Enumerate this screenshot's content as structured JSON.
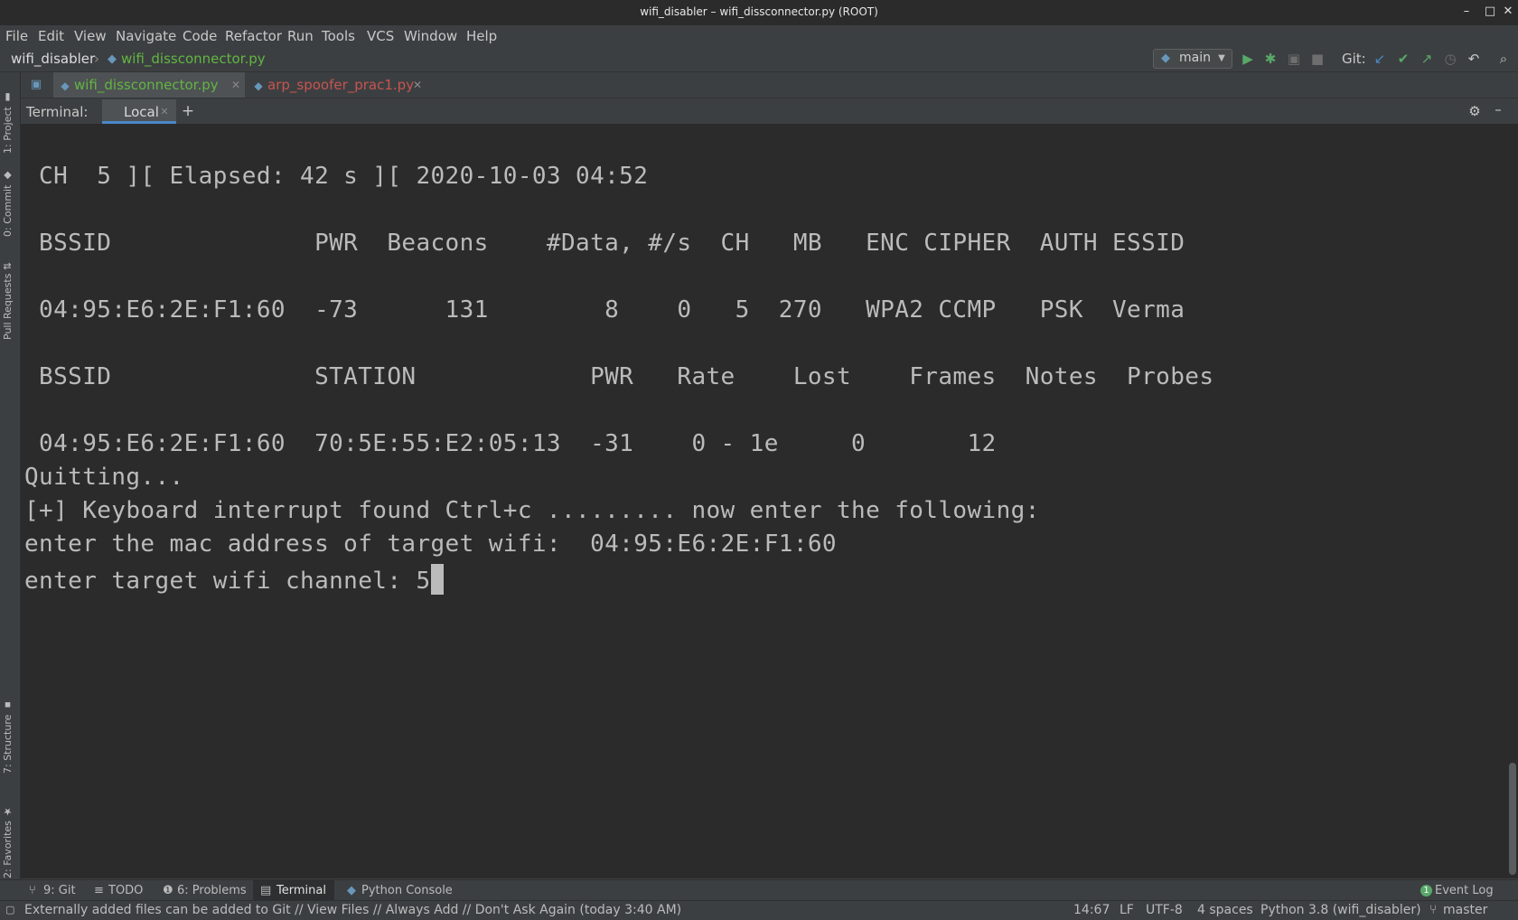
{
  "window": {
    "title": "wifi_disabler – wifi_dissconnector.py (ROOT)",
    "controls": [
      "–",
      "□",
      "✕"
    ]
  },
  "menu": [
    "File",
    "Edit",
    "View",
    "Navigate",
    "Code",
    "Refactor",
    "Run",
    "Tools",
    "VCS",
    "Window",
    "Help"
  ],
  "breadcrumb": {
    "project": "wifi_disabler",
    "file": "wifi_dissconnector.py"
  },
  "toolbar": {
    "run_config": "main",
    "git_label": "Git:"
  },
  "left_tabs": [
    "1: Project",
    "0: Commit",
    "Pull Requests",
    "7: Structure",
    "2: Favorites"
  ],
  "editor_tabs": [
    {
      "label": "wifi_dissconnector.py",
      "color": "#62b543"
    },
    {
      "label": "arp_spoofer_prac1.py",
      "color": "#c75450"
    }
  ],
  "terminal": {
    "header_label": "Terminal:",
    "tab_label": "Local",
    "lines": [
      " CH  5 ][ Elapsed: 42 s ][ 2020-10-03 04:52",
      " BSSID              PWR  Beacons    #Data, #/s  CH   MB   ENC CIPHER  AUTH ESSID",
      " 04:95:E6:2E:F1:60  -73      131        8    0   5  270   WPA2 CCMP   PSK  Verma",
      " BSSID              STATION            PWR   Rate    Lost    Frames  Notes  Probes",
      " 04:95:E6:2E:F1:60  70:5E:55:E2:05:13  -31    0 - 1e     0       12",
      "Quitting...",
      "[+] Keyboard interrupt found Ctrl+c ......... now enter the following:",
      "enter the mac address of target wifi:  04:95:E6:2E:F1:60",
      "enter target wifi channel: 5"
    ]
  },
  "bottom_tabs": [
    "9: Git",
    "TODO",
    "6: Problems",
    "Terminal",
    "Python Console"
  ],
  "event_log": "Event Log",
  "event_count": "1",
  "status": {
    "message": "Externally added files can be added to Git // View Files // Always Add // Don't Ask Again (today 3:40 AM)",
    "position": "14:67",
    "line_sep": "LF",
    "encoding": "UTF-8",
    "indent": "4 spaces",
    "interpreter": "Python 3.8 (wifi_disabler)",
    "branch": "master"
  },
  "colors": {
    "accent": "#4a88c7",
    "run_green": "#59a869",
    "python_file": "#62b543",
    "error_file": "#c75450"
  }
}
